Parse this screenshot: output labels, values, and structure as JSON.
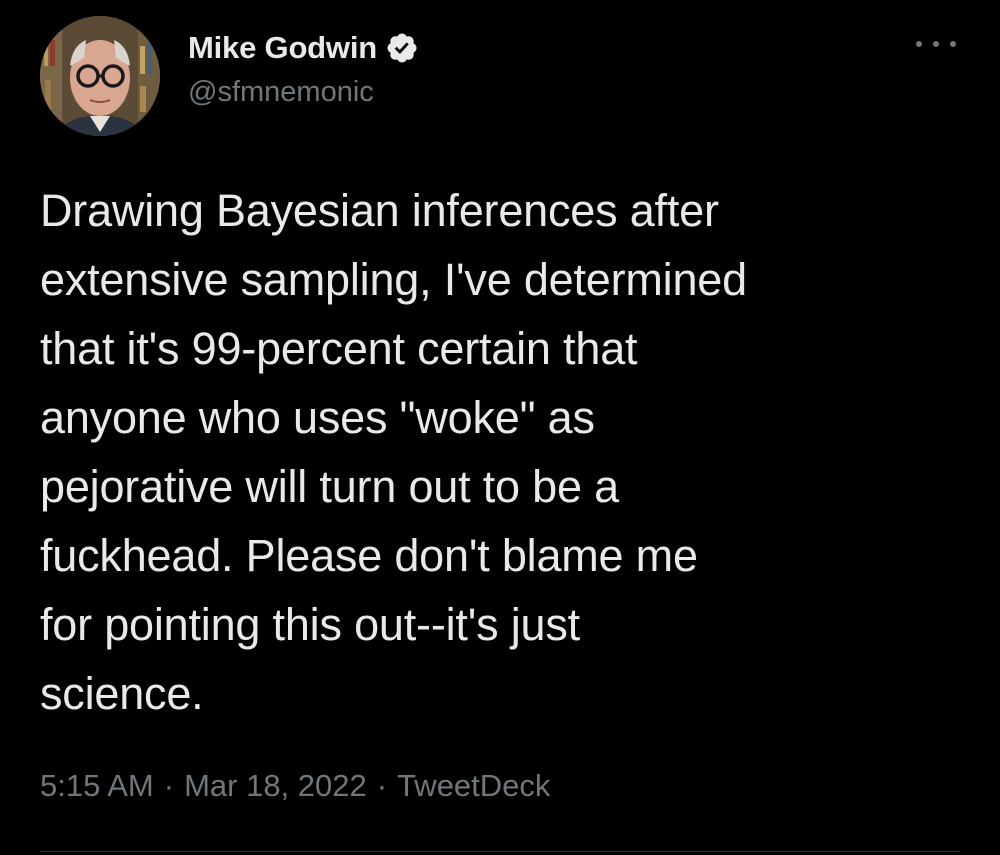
{
  "author": {
    "display_name": "Mike Godwin",
    "handle": "@sfmnemonic",
    "verified": true,
    "avatar_icon": "profile-photo"
  },
  "tweet": {
    "text": "Drawing Bayesian inferences after\nextensive sampling, I've determined\nthat it's 99-percent certain that\nanyone who uses \"woke\" as\npejorative will turn out to be a\nfuckhead. Please don't blame me\nfor pointing this out--it's just\nscience.",
    "time": "5:15 AM",
    "separator": "·",
    "date": "Mar 18, 2022",
    "source": "TweetDeck"
  },
  "icons": {
    "verified": "verified-badge-icon",
    "more": "more-options-icon"
  },
  "colors": {
    "background": "#000000",
    "text_primary": "#e7e9ea",
    "text_secondary": "#71767b",
    "divider": "#2f3336"
  }
}
